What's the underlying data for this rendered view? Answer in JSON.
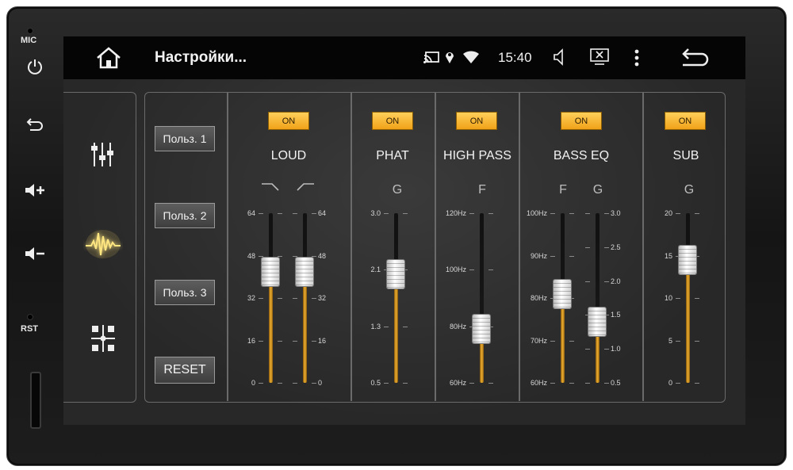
{
  "device": {
    "mic_label": "MIC",
    "rst_label": "RST"
  },
  "statusbar": {
    "title": "Настройки...",
    "time": "15:40"
  },
  "presets": [
    {
      "label": "Польз. 1"
    },
    {
      "label": "Польз. 2"
    },
    {
      "label": "Польз. 3"
    },
    {
      "label": "RESET"
    }
  ],
  "sections": {
    "loud": {
      "on_label": "ON",
      "title": "LOUD"
    },
    "phat": {
      "on_label": "ON",
      "title": "PHAT",
      "sub": "G"
    },
    "highpass": {
      "on_label": "ON",
      "title": "HIGH PASS",
      "sub": "F"
    },
    "basseq": {
      "on_label": "ON",
      "title": "BASS EQ",
      "sub_f": "F",
      "sub_g": "G"
    },
    "sub": {
      "on_label": "ON",
      "title": "SUB",
      "sub": "G"
    }
  },
  "sliders": [
    {
      "id": "loud-low",
      "ticks": [
        "64",
        "48",
        "32",
        "16",
        "0"
      ],
      "min": 0,
      "max": 64,
      "value": 42,
      "label_side": "left"
    },
    {
      "id": "loud-high",
      "ticks": [
        "64",
        "48",
        "32",
        "16",
        "0"
      ],
      "min": 0,
      "max": 64,
      "value": 42,
      "label_side": "right"
    },
    {
      "id": "phat-gain",
      "ticks": [
        "3.0",
        "2.1",
        "1.3",
        "0.5"
      ],
      "min": 0.5,
      "max": 3.0,
      "value": 2.1,
      "label_side": "left"
    },
    {
      "id": "highpass-freq",
      "ticks": [
        "120Hz",
        "100Hz",
        "80Hz",
        "60Hz"
      ],
      "min": 0,
      "max": 3,
      "value": 0.95,
      "label_side": "left"
    },
    {
      "id": "basseq-freq",
      "ticks": [
        "100Hz",
        "90Hz",
        "80Hz",
        "70Hz",
        "60Hz"
      ],
      "min": 0,
      "max": 4,
      "value": 2.1,
      "label_side": "left"
    },
    {
      "id": "basseq-gain",
      "ticks": [
        "3.0",
        "2.5",
        "2.0",
        "1.5",
        "1.0",
        "0.5"
      ],
      "min": 0.5,
      "max": 3.0,
      "value": 1.4,
      "label_side": "right"
    },
    {
      "id": "sub-gain",
      "ticks": [
        "20",
        "15",
        "10",
        "5",
        "0"
      ],
      "min": 0,
      "max": 20,
      "value": 14.5,
      "label_side": "left"
    }
  ],
  "colors": {
    "accent_on": "#f5b02a",
    "fader_fill": "#e0a020",
    "glow": "#ffe06a"
  }
}
